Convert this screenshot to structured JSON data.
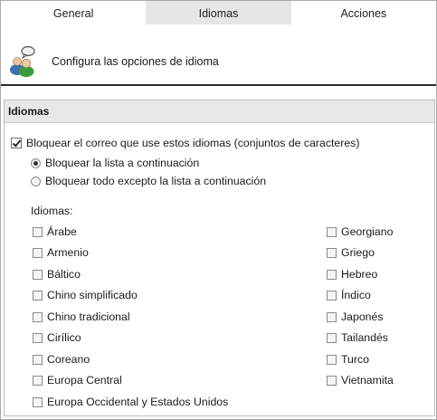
{
  "tabs": [
    {
      "label": "General",
      "active": false
    },
    {
      "label": "Idiomas",
      "active": true
    },
    {
      "label": "Acciones",
      "active": false
    }
  ],
  "header": {
    "icon": "users-language-icon",
    "text": "Configura las opciones de idioma"
  },
  "group": {
    "title": "Idiomas",
    "block_checkbox": {
      "label": "Bloquear el correo que use estos idiomas (conjuntos de caracteres)",
      "checked": true
    },
    "radio_options": [
      {
        "label": "Bloquear la lista a continuación",
        "selected": true
      },
      {
        "label": "Bloquear todo excepto la lista a continuación",
        "selected": false
      }
    ],
    "languages_label": "Idiomas:",
    "languages_left": [
      "Árabe",
      "Armenio",
      "Báltico",
      "Chino simplificado",
      "Chino tradicional",
      "Cirílico",
      "Coreano",
      "Europa Central",
      "Europa Occidental y Estados Unidos"
    ],
    "languages_right": [
      "Georgiano",
      "Griego",
      "Hebreo",
      "Índico",
      "Japonés",
      "Tailandés",
      "Turco",
      "Vietnamita"
    ]
  }
}
